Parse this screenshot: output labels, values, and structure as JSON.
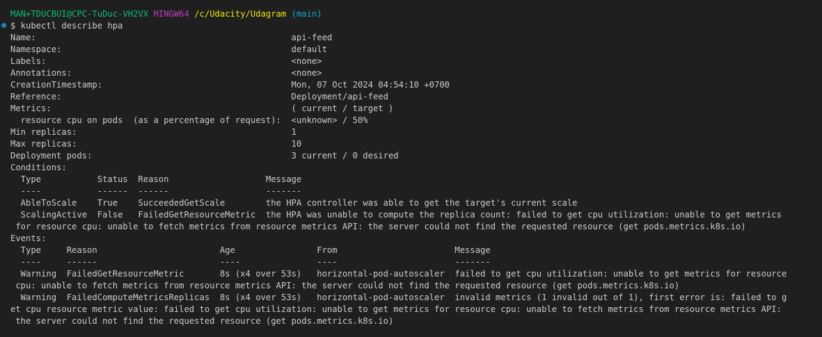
{
  "prompt": {
    "user_host": "MAN+TDUCBUI@CPC-TuDuc-VH2VX",
    "system": "MINGW64",
    "path": "/c/Udacity/Udagram",
    "branch": "(main)"
  },
  "command": "$ kubectl describe hpa",
  "output_lines": [
    "Name:                                                  api-feed",
    "Namespace:                                             default",
    "Labels:                                                <none>",
    "Annotations:                                           <none>",
    "CreationTimestamp:                                     Mon, 07 Oct 2024 04:54:10 +0700",
    "Reference:                                             Deployment/api-feed",
    "Metrics:                                               ( current / target )",
    "  resource cpu on pods  (as a percentage of request):  <unknown> / 50%",
    "Min replicas:                                          1",
    "Max replicas:                                          10",
    "Deployment pods:                                       3 current / 0 desired",
    "Conditions:",
    "  Type           Status  Reason                   Message",
    "  ----           ------  ------                   -------",
    "  AbleToScale    True    SucceededGetScale        the HPA controller was able to get the target's current scale",
    "  ScalingActive  False   FailedGetResourceMetric  the HPA was unable to compute the replica count: failed to get cpu utilization: unable to get metrics",
    " for resource cpu: unable to fetch metrics from resource metrics API: the server could not find the requested resource (get pods.metrics.k8s.io)",
    "Events:",
    "  Type     Reason                        Age                From                       Message",
    "  ----     ------                        ----               ----                       -------",
    "  Warning  FailedGetResourceMetric       8s (x4 over 53s)   horizontal-pod-autoscaler  failed to get cpu utilization: unable to get metrics for resource",
    " cpu: unable to fetch metrics from resource metrics API: the server could not find the requested resource (get pods.metrics.k8s.io)",
    "  Warning  FailedComputeMetricsReplicas  8s (x4 over 53s)   horizontal-pod-autoscaler  invalid metrics (1 invalid out of 1), first error is: failed to g",
    "et cpu resource metric value: failed to get cpu utilization: unable to get metrics for resource cpu: unable to fetch metrics from resource metrics API:",
    " the server could not find the requested resource (get pods.metrics.k8s.io)"
  ],
  "colors": {
    "background": "#1f1f1f",
    "foreground": "#cccccc",
    "prompt_user": "#0dbc79",
    "prompt_system": "#bc3fbc",
    "prompt_path": "#e5e510",
    "prompt_branch": "#11a8cd",
    "command_marker": "#1a85c6"
  }
}
